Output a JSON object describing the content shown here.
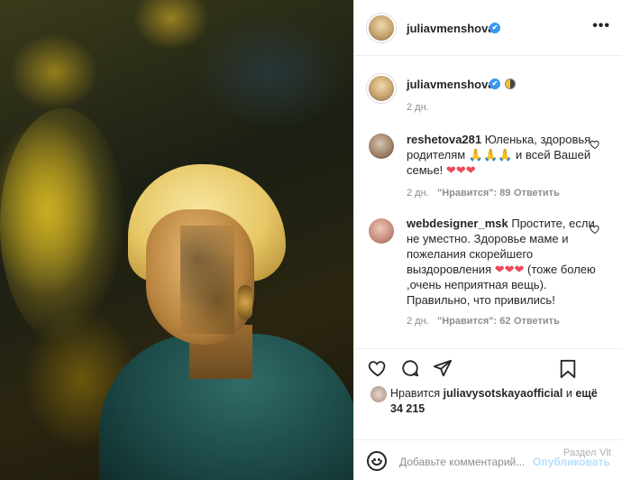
{
  "post": {
    "username": "juliavmenshova",
    "verified_mark": "✔",
    "more_label": "•••"
  },
  "caption": {
    "username": "juliavmenshova",
    "time": "2 дн."
  },
  "comments": [
    {
      "username": "reshetova281",
      "text": "Юленька, здоровья родителям",
      "text_tail": "и всей Вашей семье!",
      "hands": "🙏🙏🙏",
      "hearts": "❤❤❤",
      "time": "2 дн.",
      "likes": "\"Нравится\": 89",
      "reply": "Ответить"
    },
    {
      "username": "webdesigner_msk",
      "text": "Простите, если не уместно. Здоровье маме и пожелания скорейшего выздоровления",
      "hearts": "❤❤❤",
      "text_tail": "(тоже болею ,очень неприятная вещь). Правильно, что привились!",
      "time": "2 дн.",
      "likes": "\"Нравится\": 62",
      "reply": "Ответить"
    }
  ],
  "likes": {
    "prefix": "Нравится",
    "user": "juliavysotskayaofficial",
    "connector": "и",
    "count_text": "ещё 34 215"
  },
  "add_comment": {
    "placeholder": "Добавьте комментарий...",
    "publish": "Опубликовать"
  },
  "watermark": {
    "line1": "Раздел",
    "line2": "Vlt"
  },
  "colors": {
    "verified": "#3897f0",
    "heart_red": "#ed4956",
    "muted": "#8e8e8e",
    "publish": "#b2dffc"
  },
  "icons": [
    "more-icon",
    "verified-icon",
    "heart-icon",
    "comment-icon",
    "share-icon",
    "bookmark-icon",
    "emoji-icon"
  ]
}
